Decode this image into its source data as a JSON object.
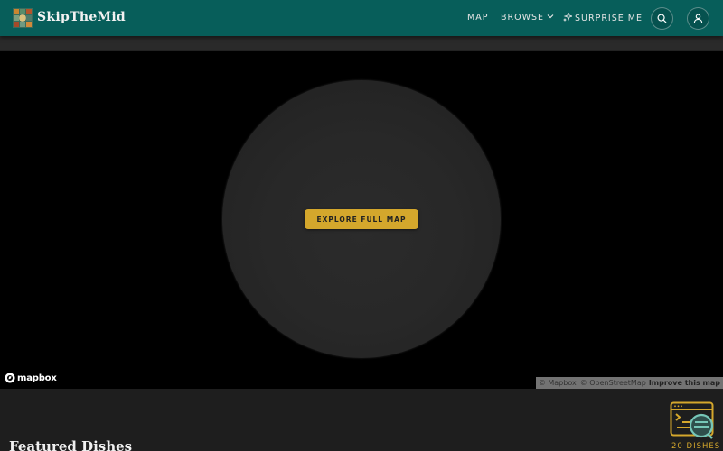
{
  "header": {
    "brand": "SkipTheMid",
    "nav": {
      "map": "MAP",
      "browse": "BROWSE",
      "surprise": "SURPRISE ME"
    }
  },
  "map": {
    "explore_button": "EXPLORE FULL MAP",
    "logo_text": "mapbox",
    "attribution": {
      "mapbox": "© Mapbox",
      "osm": "© OpenStreetMap",
      "improve": "Improve this map"
    }
  },
  "featured": {
    "title": "Featured Dishes",
    "count": "20 DISHES"
  },
  "colors": {
    "header_bg": "#075e5a",
    "accent": "#d4a72c",
    "page_bg": "#1a1a1a"
  },
  "icons": [
    "logo-icon",
    "search-icon",
    "user-icon",
    "chevron-down-icon",
    "sparkle-icon",
    "mapbox-icon",
    "dishes-list-icon"
  ]
}
